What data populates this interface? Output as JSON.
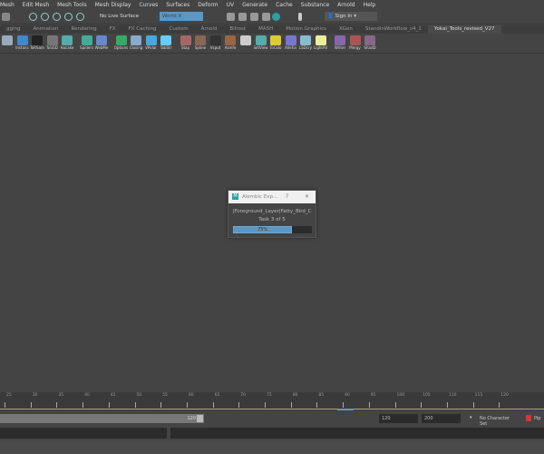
{
  "menubar": [
    "Mesh",
    "Edit Mesh",
    "Mesh Tools",
    "Mesh Display",
    "Curves",
    "Surfaces",
    "Deform",
    "UV",
    "Generate",
    "Cache",
    "Substance",
    "Arnold",
    "Help"
  ],
  "status": {
    "live_surface": "No Live Surface",
    "world_field": "World X",
    "sign_in": "Sign In"
  },
  "tabs": [
    "gging",
    "Animation",
    "Rendering",
    "FX",
    "FX Caching",
    "Custom",
    "Arnold",
    "Bifrost",
    "MASH",
    "Motion Graphics",
    "XGen",
    "StandinWorkflow_v4_1",
    "Yokai_Tools_revised_V27"
  ],
  "active_tab": "Yokai_Tools_revised_V27",
  "shelf": [
    "",
    "Instanc",
    "ToRSam",
    "ToSGD",
    "Hacake",
    "Spiders",
    "WebMe",
    "Options",
    "Closing",
    "VPolar",
    "TabStr",
    "Stap",
    "Spline",
    "Vsput",
    "Asmfe",
    "",
    "SetView",
    "ToColo",
    "AlleToi",
    "LSDcry",
    "LightAll",
    "Writer",
    "Mergy",
    "ShadD"
  ],
  "dialog": {
    "title": "Alembic Exp...",
    "help": "?",
    "close": "✕",
    "item": "|Foreground_Layer|Fatty_Bird_C",
    "task": "Task 3 of 5",
    "progress_label": "75%",
    "progress": 75
  },
  "timeline": {
    "ticks": [
      25,
      30,
      35,
      40,
      45,
      50,
      55,
      60,
      65,
      70,
      75,
      80,
      85,
      90,
      95,
      100,
      105,
      110,
      115,
      120
    ],
    "current_frame": 90
  },
  "range": {
    "slider_end": "120",
    "end": "120",
    "max": "200",
    "character_set": "No Character Set",
    "pip": "Pip"
  }
}
